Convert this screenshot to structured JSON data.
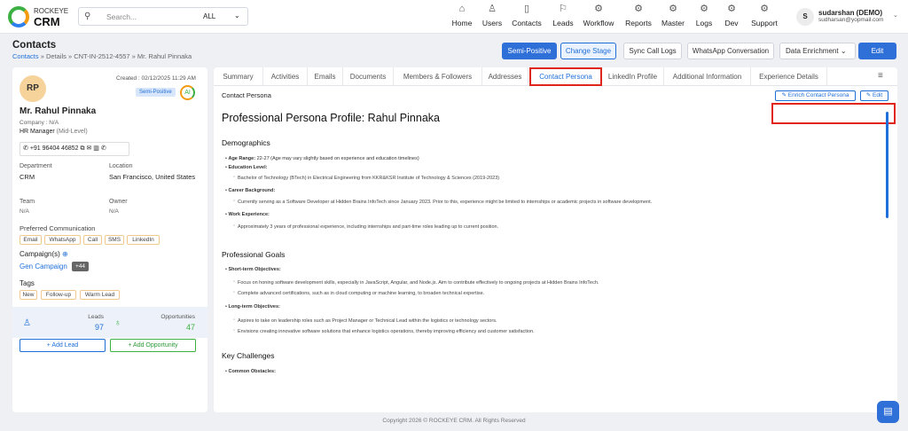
{
  "brand": {
    "line1": "ROCKEYE",
    "line2": "CRM"
  },
  "search": {
    "placeholder": "Search...",
    "scope": "ALL"
  },
  "nav": [
    {
      "icon": "home-icon",
      "label": "Home",
      "glyph": "⌂"
    },
    {
      "icon": "users-icon",
      "label": "Users",
      "glyph": "♙"
    },
    {
      "icon": "contacts-icon",
      "label": "Contacts",
      "glyph": "▯"
    },
    {
      "icon": "leads-icon",
      "label": "Leads",
      "glyph": "⚐"
    },
    {
      "icon": "workflow-icon",
      "label": "Workflow",
      "glyph": "⚙"
    },
    {
      "icon": "reports-icon",
      "label": "Reports",
      "glyph": "⚙"
    },
    {
      "icon": "master-icon",
      "label": "Master",
      "glyph": "⚙"
    },
    {
      "icon": "logs-icon",
      "label": "Logs",
      "glyph": "⚙"
    },
    {
      "icon": "dev-icon",
      "label": "Dev",
      "glyph": "⚙"
    },
    {
      "icon": "support-icon",
      "label": "Support",
      "glyph": "⚙"
    }
  ],
  "user": {
    "initial": "S",
    "name": "sudarshan (DEMO)",
    "email": "sudharsan@yopmail.com"
  },
  "page": {
    "title": "Contacts",
    "crumb_root": "Contacts",
    "crumb_rest": "» Details » CNT-IN-2512-4557 » Mr. Rahul Pinnaka"
  },
  "actions": {
    "status": "Semi-Positive",
    "change_stage": "Change Stage",
    "sync": "Sync Call Logs",
    "whatsapp": "WhatsApp Conversation",
    "enrichment": "Data Enrichment",
    "edit": "Edit"
  },
  "contact": {
    "initials": "RP",
    "created": "Created : 02/12/2025 11:29 AM",
    "status": "Semi-Positive",
    "ai": "AI",
    "name": "Mr. Rahul Pinnaka",
    "company": "Company : N/A",
    "role": "HR Manager",
    "level": "(Mid-Level)",
    "phone": "+91 96404 46852",
    "department_label": "Department",
    "department": "CRM",
    "location_label": "Location",
    "location": "San Francisco, United States",
    "team_label": "Team",
    "team": "N/A",
    "owner_label": "Owner",
    "owner": "N/A",
    "pref_label": "Preferred Communication",
    "prefs": [
      "Email",
      "WhatsApp",
      "Call",
      "SMS",
      "LinkedIn"
    ],
    "campaign_label": "Campaign(s)",
    "campaign": "Gen Campaign",
    "campaign_more": "+44",
    "tags_label": "Tags",
    "tags": [
      "New",
      "Follow-up",
      "Warm Lead"
    ],
    "leads_label": "Leads",
    "leads": "97",
    "opps_label": "Opportunities",
    "opps": "47",
    "add_lead": "+ Add Lead",
    "add_opp": "+ Add Opportunity"
  },
  "tabs": [
    "Summary",
    "Activities",
    "Emails",
    "Documents",
    "Members & Followers",
    "Addresses",
    "Contact Persona",
    "LinkedIn Profile",
    "Additional Information",
    "Experience Details"
  ],
  "persona": {
    "section": "Contact Persona",
    "enrich": "Enrich Contact Persona",
    "edit": "Edit",
    "title": "Professional Persona Profile: Rahul Pinnaka",
    "demographics": "Demographics",
    "age_label": "Age Range:",
    "age": "22-27 (Age may vary slightly based on experience and education timelines)",
    "edu_label": "Education Level:",
    "edu": "Bachelor of Technology (BTech) in Electrical Engineering from KKR&KSR Institute of Technology & Sciences (2019-2023)",
    "career_label": "Career Background:",
    "career": "Currently serving as a Software Developer at Hidden Brains InfoTech since January 2023. Prior to this, experience might be limited to internships or academic projects in software development.",
    "work_label": "Work Experience:",
    "work": "Approximately 3 years of professional experience, including internships and part-time roles leading up to current position.",
    "goals": "Professional Goals",
    "short_label": "Short-term Objectives:",
    "short1": "Focus on honing software development skills, especially in JavaScript, Angular, and Node.js. Aim to contribute effectively to ongoing projects at Hidden Brains InfoTech.",
    "short2": "Complete advanced certifications, such as in cloud computing or machine learning, to broaden technical expertise.",
    "long_label": "Long-term Objectives:",
    "long1": "Aspires to take on leadership roles such as Project Manager or Technical Lead within the logistics or technology sectors.",
    "long2": "Envisions creating innovative software solutions that enhance logistics operations, thereby improving efficiency and customer satisfaction.",
    "challenges": "Key Challenges",
    "obstacles_label": "Common Obstacles:"
  },
  "footer": "Copyright 2026 © ROCKEYE CRM. All Rights Reserved"
}
